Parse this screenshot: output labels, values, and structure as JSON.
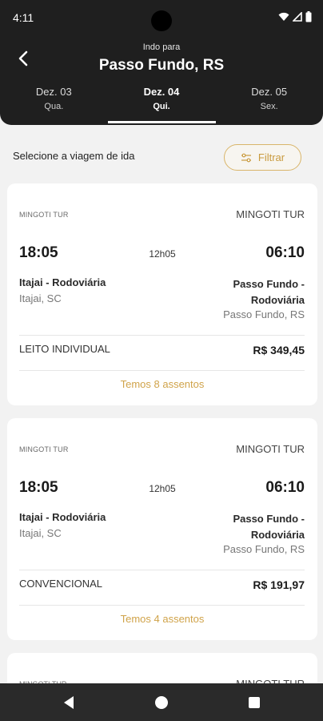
{
  "status": {
    "time": "4:11"
  },
  "header": {
    "subtitle": "Indo para",
    "title": "Passo Fundo, RS"
  },
  "date_tabs": [
    {
      "date": "Dez. 03",
      "weekday": "Qua."
    },
    {
      "date": "Dez. 04",
      "weekday": "Qui."
    },
    {
      "date": "Dez. 05",
      "weekday": "Sex."
    }
  ],
  "active_tab": "Dez. 04",
  "toolbar": {
    "select_label": "Selecione a viagem de ida",
    "filter_label": "Filtrar"
  },
  "trips": [
    {
      "operator_small": "MINGOTI TUR",
      "operator": "MINGOTI TUR",
      "departure": "18:05",
      "duration": "12h05",
      "arrival": "06:10",
      "origin_name": "Itajai - Rodoviária",
      "origin_city": "Itajai, SC",
      "dest_name": "Passo Fundo - Rodoviária",
      "dest_city": "Passo Fundo, RS",
      "seat_class": "LEITO INDIVIDUAL",
      "price": "R$ 349,45",
      "seats": "Temos 8 assentos"
    },
    {
      "operator_small": "MINGOTI TUR",
      "operator": "MINGOTI TUR",
      "departure": "18:05",
      "duration": "12h05",
      "arrival": "06:10",
      "origin_name": "Itajai - Rodoviária",
      "origin_city": "Itajai, SC",
      "dest_name": "Passo Fundo - Rodoviária",
      "dest_city": "Passo Fundo, RS",
      "seat_class": "CONVENCIONAL",
      "price": "R$ 191,97",
      "seats": "Temos 4 assentos"
    },
    {
      "operator_small": "MINGOTI TUR",
      "operator": "MINGOTI TUR"
    }
  ],
  "colors": {
    "header_bg": "#1f1f1f",
    "accent": "#d0a34a",
    "page_bg": "#f2f2f2"
  },
  "icons": {
    "back": "chevron-left-icon",
    "filter": "sliders-icon",
    "wifi": "wifi-icon",
    "signal": "signal-icon",
    "battery": "battery-icon"
  }
}
